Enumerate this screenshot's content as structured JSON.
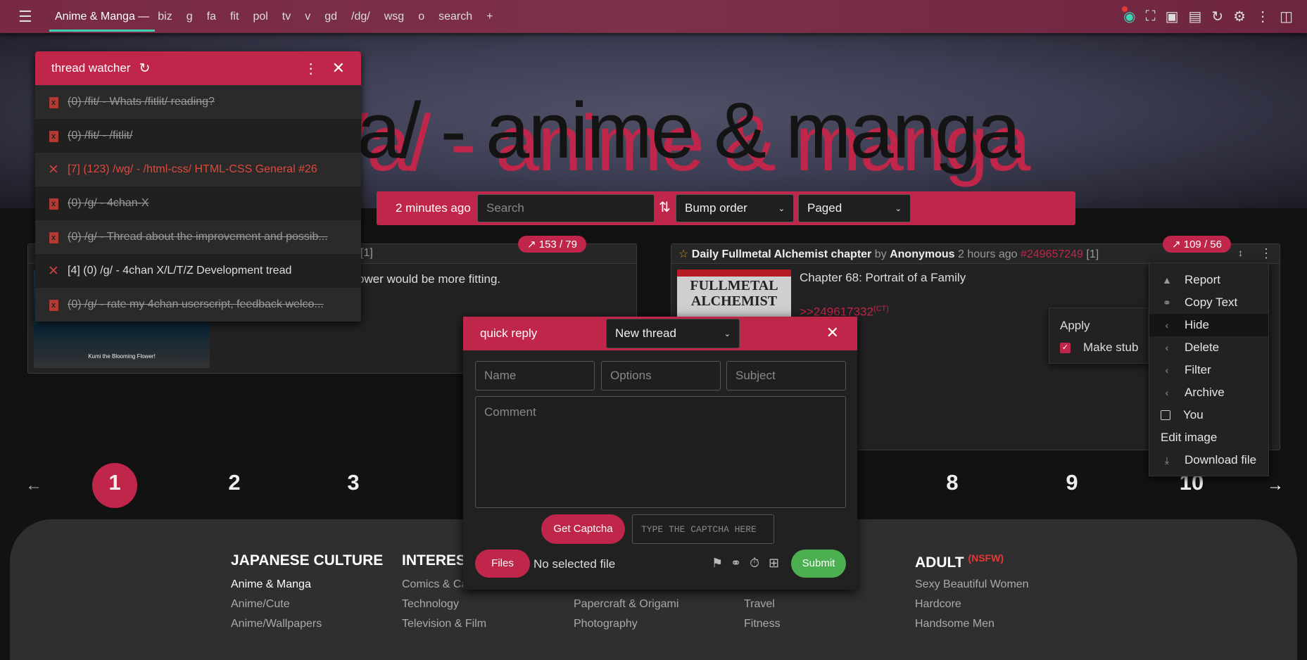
{
  "topbar": {
    "active_tab": "Anime & Manga —",
    "links": [
      "biz",
      "g",
      "fa",
      "fit",
      "pol",
      "tv",
      "v",
      "gd",
      "/dg/",
      "wsg",
      "o",
      "search",
      "+"
    ],
    "icons": [
      "eye-icon",
      "fullscreen-icon",
      "image-icon",
      "comment-icon",
      "refresh-icon",
      "gear-icon",
      "more-icon",
      "clipboard-code-icon"
    ]
  },
  "banner": {
    "title": "/a/ - anime & manga"
  },
  "filterbar": {
    "updated": "2 minutes ago",
    "search_placeholder": "Search",
    "sort": "Bump order",
    "mode": "Paged"
  },
  "watcher": {
    "title": "thread watcher",
    "items": [
      {
        "text": "(0) /fit/ - Whats /fitlit/ reading?",
        "icon": "trash",
        "state": "dead"
      },
      {
        "text": "(0) /fit/ - /fitlit/",
        "icon": "trash",
        "state": "dead"
      },
      {
        "text": "[7] (123) /wg/ - /html-css/ HTML-CSS General #26",
        "icon": "x",
        "state": "unread"
      },
      {
        "text": "(0) /g/ - 4chan-X",
        "icon": "trash",
        "state": "dead"
      },
      {
        "text": "(0) /g/ - Thread about the improvement and possib...",
        "icon": "trash",
        "state": "dead"
      },
      {
        "text": "[4] (0) /g/ - 4chan X/L/T/Z Development tread",
        "icon": "x",
        "state": "normal"
      },
      {
        "text": "(0) /g/ - rate my 4chan userscript, feedback welco...",
        "icon": "trash",
        "state": "dead"
      }
    ]
  },
  "thread1": {
    "badge_replies": "153",
    "badge_images": "79",
    "refs": "[1]",
    "comment": "ower would be more fitting.",
    "thumb_caption": "Kumi the Blooming Flower!"
  },
  "thread2": {
    "badge_replies": "109",
    "badge_images": "56",
    "subject": "Daily Fullmetal Alchemist chapter",
    "by": "by",
    "author": "Anonymous",
    "time": "2 hours ago",
    "postno": "#249657249",
    "refs": "[1]",
    "comment": "Chapter 68: Portrait of a Family",
    "quote": ">>249617332",
    "quote_tag": "(CT)",
    "thumb_text": "FULLMETAL ALCHEMIST"
  },
  "context_menu": {
    "items": [
      "Report",
      "Copy Text",
      "Hide",
      "Delete",
      "Filter",
      "Archive",
      "You",
      "Edit image",
      "Download file"
    ],
    "submenu": {
      "title": "Apply",
      "option": "Make stub",
      "checked": true
    }
  },
  "quick_reply": {
    "title": "quick reply",
    "target": "New thread",
    "name_ph": "Name",
    "options_ph": "Options",
    "subject_ph": "Subject",
    "comment_ph": "Comment",
    "captcha_btn": "Get Captcha",
    "captcha_ph": "TYPE THE CAPTCHA HERE",
    "files_btn": "Files",
    "file_status": "No selected file",
    "submit": "Submit"
  },
  "pagination": {
    "current": 1,
    "pages": [
      "1",
      "2",
      "3",
      "8",
      "9",
      "10"
    ]
  },
  "footer": {
    "columns": [
      {
        "heading": "JAPANESE CULTURE",
        "links": [
          "Anime & Manga",
          "Anime/Cute",
          "Anime/Wallpapers"
        ]
      },
      {
        "heading": "INTERESTS",
        "links": [
          "Comics & Cartoons",
          "Technology",
          "Television & Film"
        ]
      },
      {
        "heading": "",
        "links": [
          "",
          "Papercraft & Origami",
          "Photography"
        ]
      },
      {
        "heading": "",
        "links": [
          "",
          "Travel",
          "Fitness"
        ]
      },
      {
        "heading": "ADULT",
        "tag": "(NSFW)",
        "links": [
          "Sexy Beautiful Women",
          "Hardcore",
          "Handsome Men"
        ]
      }
    ]
  },
  "colors": {
    "accent": "#c0264a",
    "topbar": "#7a2b46",
    "tab_underline": "#3fd1b4",
    "submit": "#4caf50"
  }
}
